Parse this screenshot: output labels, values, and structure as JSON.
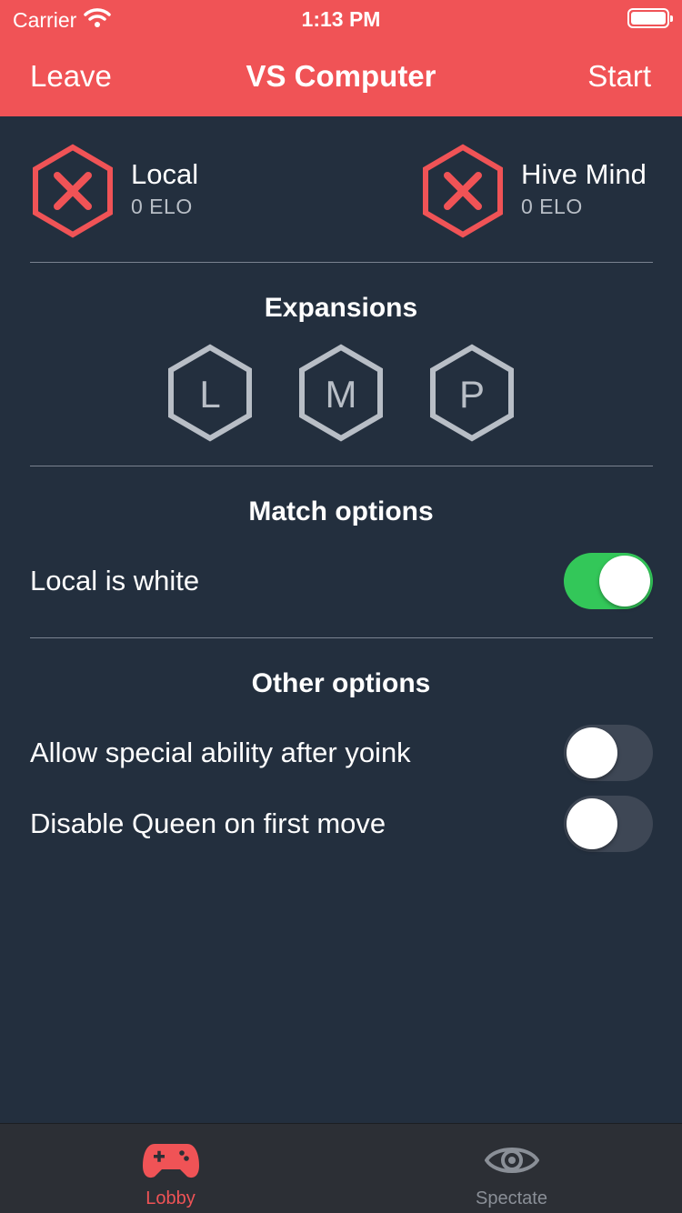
{
  "status_bar": {
    "carrier": "Carrier",
    "time": "1:13 PM"
  },
  "nav": {
    "left": "Leave",
    "title": "VS Computer",
    "right": "Start"
  },
  "players": [
    {
      "name": "Local",
      "elo": "0 ELO"
    },
    {
      "name": "Hive Mind",
      "elo": "0 ELO"
    }
  ],
  "sections": {
    "expansions": "Expansions",
    "match": "Match options",
    "other": "Other options"
  },
  "expansions": [
    {
      "letter": "L",
      "enabled": false
    },
    {
      "letter": "M",
      "enabled": false
    },
    {
      "letter": "P",
      "enabled": false
    }
  ],
  "match_options": [
    {
      "label": "Local is white",
      "on": true
    }
  ],
  "other_options": [
    {
      "label": "Allow special ability after yoink",
      "on": false
    },
    {
      "label": "Disable Queen on first move",
      "on": false
    }
  ],
  "tabs": [
    {
      "label": "Lobby",
      "icon": "gamepad-icon",
      "active": true
    },
    {
      "label": "Spectate",
      "icon": "eye-icon",
      "active": false
    }
  ],
  "colors": {
    "accent": "#f05356",
    "background": "#232f3e",
    "toggle_on": "#33c759",
    "toggle_off": "#3e4755",
    "expansion_gray": "#b8bec6"
  }
}
